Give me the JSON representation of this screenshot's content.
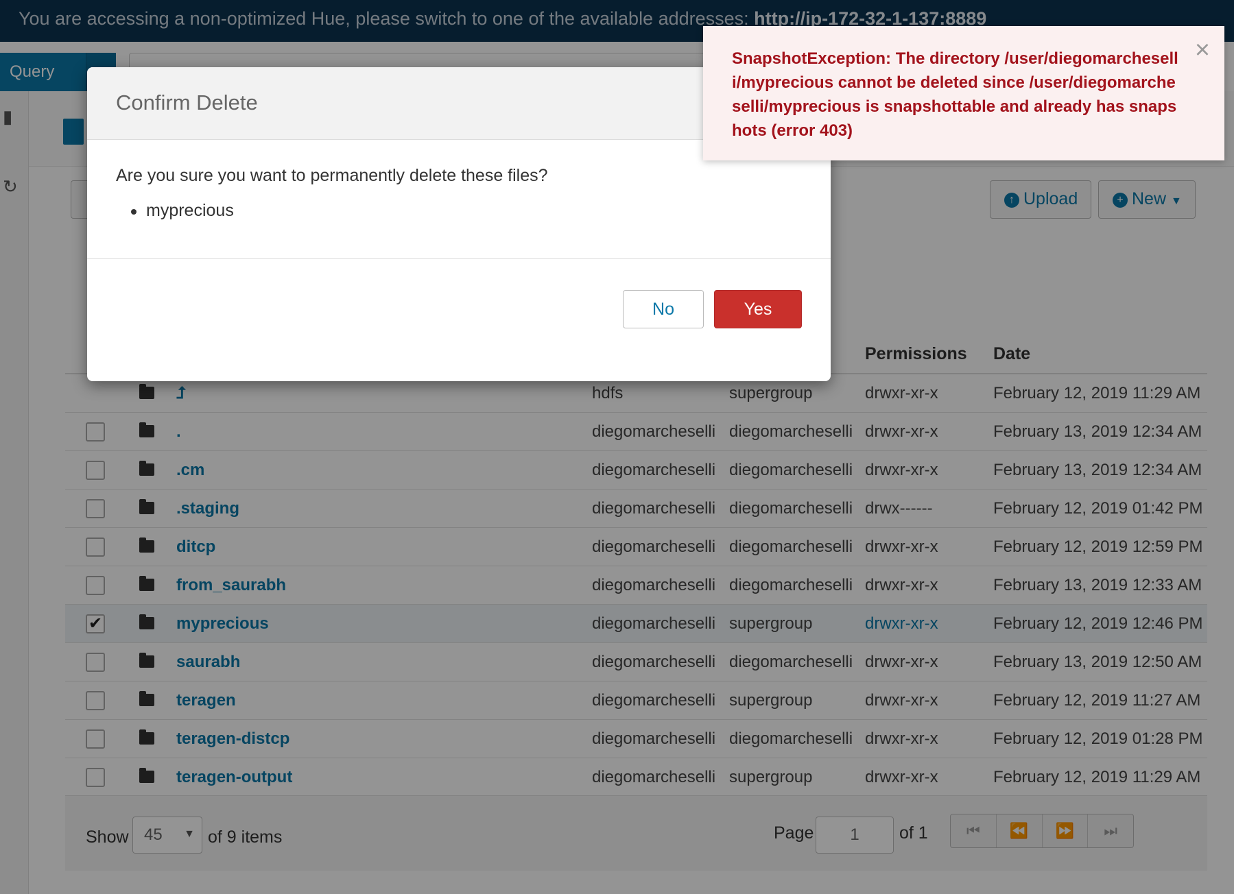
{
  "banner": {
    "text": "You are accessing a non-optimized Hue, please switch to one of the available addresses: ",
    "link": "http://ip-172-32-1-137:8889"
  },
  "topbar": {
    "query_label": "Query"
  },
  "toolbar": {
    "upload_label": "Upload",
    "new_label": "New"
  },
  "table": {
    "headers": {
      "permissions": "Permissions",
      "date": "Date"
    },
    "rows": [
      {
        "name": "",
        "user": "hdfs",
        "group": "supergroup",
        "perm": "drwxr-xr-x",
        "date": "February 12, 2019 11:29 AM",
        "checked": false,
        "up": true
      },
      {
        "name": ".",
        "user": "diegomarcheselli",
        "group": "diegomarcheselli",
        "perm": "drwxr-xr-x",
        "date": "February 13, 2019 12:34 AM",
        "checked": false
      },
      {
        "name": ".cm",
        "user": "diegomarcheselli",
        "group": "diegomarcheselli",
        "perm": "drwxr-xr-x",
        "date": "February 13, 2019 12:34 AM",
        "checked": false
      },
      {
        "name": ".staging",
        "user": "diegomarcheselli",
        "group": "diegomarcheselli",
        "perm": "drwx------",
        "date": "February 12, 2019 01:42 PM",
        "checked": false
      },
      {
        "name": "ditcp",
        "user": "diegomarcheselli",
        "group": "diegomarcheselli",
        "perm": "drwxr-xr-x",
        "date": "February 12, 2019 12:59 PM",
        "checked": false
      },
      {
        "name": "from_saurabh",
        "user": "diegomarcheselli",
        "group": "diegomarcheselli",
        "perm": "drwxr-xr-x",
        "date": "February 13, 2019 12:33 AM",
        "checked": false
      },
      {
        "name": "myprecious",
        "user": "diegomarcheselli",
        "group": "supergroup",
        "perm": "drwxr-xr-x",
        "date": "February 12, 2019 12:46 PM",
        "checked": true
      },
      {
        "name": "saurabh",
        "user": "diegomarcheselli",
        "group": "diegomarcheselli",
        "perm": "drwxr-xr-x",
        "date": "February 13, 2019 12:50 AM",
        "checked": false
      },
      {
        "name": "teragen",
        "user": "diegomarcheselli",
        "group": "supergroup",
        "perm": "drwxr-xr-x",
        "date": "February 12, 2019 11:27 AM",
        "checked": false
      },
      {
        "name": "teragen-distcp",
        "user": "diegomarcheselli",
        "group": "diegomarcheselli",
        "perm": "drwxr-xr-x",
        "date": "February 12, 2019 01:28 PM",
        "checked": false
      },
      {
        "name": "teragen-output",
        "user": "diegomarcheselli",
        "group": "supergroup",
        "perm": "drwxr-xr-x",
        "date": "February 12, 2019 11:29 AM",
        "checked": false
      }
    ]
  },
  "footer": {
    "show_label": "Show",
    "page_size": "45",
    "items_label": "of 9 items",
    "page_label": "Page",
    "page_value": "1",
    "of_pages": "of 1"
  },
  "modal": {
    "title": "Confirm Delete",
    "question": "Are you sure you want to permanently delete these files?",
    "files": [
      "myprecious"
    ],
    "no_label": "No",
    "yes_label": "Yes"
  },
  "toast": {
    "message": "SnapshotException: The directory /user/diegomarcheselli/myprecious cannot be deleted since /user/diegomarcheselli/myprecious is snapshottable and already has snapshots (error 403)"
  },
  "colors": {
    "accent": "#0b78a8",
    "danger": "#c9302c",
    "error_text": "#a3131c",
    "banner_bg": "#0b3350"
  }
}
